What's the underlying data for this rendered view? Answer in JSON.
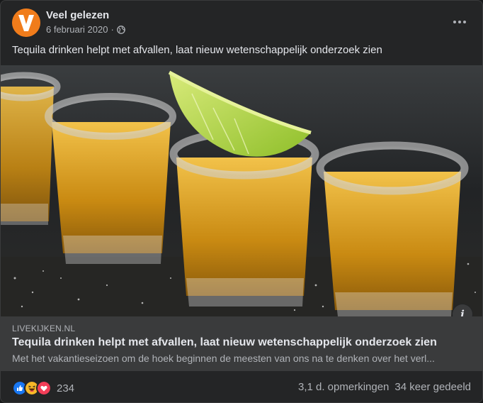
{
  "post": {
    "page_name": "Veel gelezen",
    "date": "6 februari 2020",
    "separator": "·",
    "avatar_letter": "V",
    "text": "Tequila drinken helpt met afvallen, laat nieuw wetenschappelijk onderzoek zien"
  },
  "link": {
    "domain": "LIVEKIJKEN.NL",
    "title": "Tequila drinken helpt met afvallen, laat nieuw wetenschappelijk onderzoek zien",
    "description": "Met het vakantieseizoen om de hoek beginnen de meesten van ons na te denken over het verl...",
    "info_label": "i"
  },
  "footer": {
    "reaction_count": "234",
    "comments": "3,1 d. opmerkingen",
    "shares": "34 keer gedeeld",
    "reactions": [
      "like-icon",
      "haha-icon",
      "love-icon"
    ]
  },
  "colors": {
    "background": "#242526",
    "avatar": "#f07c1b",
    "text_primary": "#e4e6eb",
    "text_secondary": "#b0b3b8",
    "link_meta_bg": "#3a3b3c",
    "like": "#1877f2",
    "haha": "#f7b928",
    "love": "#f33e58"
  }
}
